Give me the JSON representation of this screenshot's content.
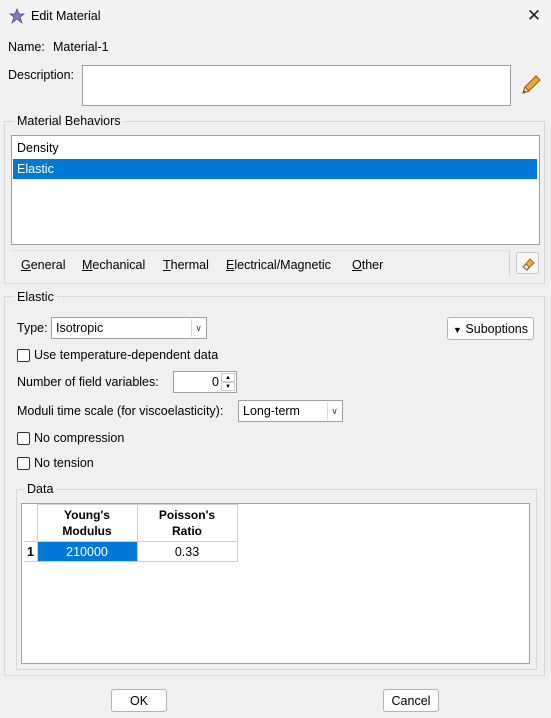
{
  "window": {
    "title": "Edit Material",
    "close_glyph": "✕",
    "icon": "abaqus-app-icon"
  },
  "name": {
    "label": "Name:",
    "value": "Material-1"
  },
  "description": {
    "label": "Description:",
    "value": "",
    "edit_icon": "pencil-icon"
  },
  "material_behaviors": {
    "title": "Material Behaviors",
    "items": [
      "Density",
      "Elastic"
    ],
    "selected": "Elastic",
    "tabs": [
      {
        "mnemonic": "G",
        "rest": "eneral"
      },
      {
        "mnemonic": "M",
        "rest": "echanical"
      },
      {
        "mnemonic": "T",
        "rest": "hermal"
      },
      {
        "mnemonic": "E",
        "rest": "lectrical/Magnetic"
      },
      {
        "mnemonic": "O",
        "rest": "ther"
      }
    ],
    "tabs_icon": "eraser-icon"
  },
  "elastic": {
    "title": "Elastic",
    "type_label": "Type:",
    "type_value": "Isotropic",
    "suboptions_label": "Suboptions",
    "use_temp_label": "Use temperature-dependent data",
    "use_temp_checked": false,
    "field_vars_label": "Number of field variables:",
    "field_vars_value": "0",
    "moduli_label": "Moduli time scale (for viscoelasticity):",
    "moduli_value": "Long-term",
    "no_compression_label": "No compression",
    "no_compression_checked": false,
    "no_tension_label": "No tension",
    "no_tension_checked": false
  },
  "data_table": {
    "title": "Data",
    "columns": [
      [
        "Young's",
        "Modulus"
      ],
      [
        "Poisson's",
        "Ratio"
      ]
    ],
    "rows": [
      {
        "index": "1",
        "values": [
          "210000",
          "0.33"
        ]
      }
    ]
  },
  "buttons": {
    "ok": "OK",
    "cancel": "Cancel"
  },
  "colors": {
    "selection": "#0078d7",
    "background": "#f0f0f0"
  }
}
